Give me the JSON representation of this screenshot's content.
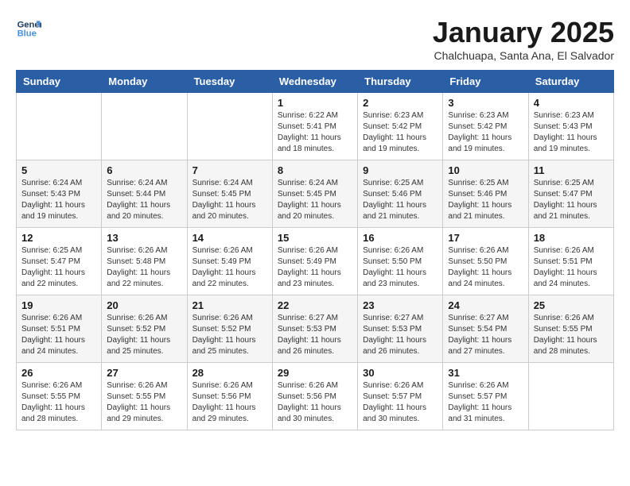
{
  "logo": {
    "line1": "General",
    "line2": "Blue"
  },
  "title": "January 2025",
  "subtitle": "Chalchuapa, Santa Ana, El Salvador",
  "weekdays": [
    "Sunday",
    "Monday",
    "Tuesday",
    "Wednesday",
    "Thursday",
    "Friday",
    "Saturday"
  ],
  "weeks": [
    [
      {
        "day": "",
        "info": ""
      },
      {
        "day": "",
        "info": ""
      },
      {
        "day": "",
        "info": ""
      },
      {
        "day": "1",
        "info": "Sunrise: 6:22 AM\nSunset: 5:41 PM\nDaylight: 11 hours\nand 18 minutes."
      },
      {
        "day": "2",
        "info": "Sunrise: 6:23 AM\nSunset: 5:42 PM\nDaylight: 11 hours\nand 19 minutes."
      },
      {
        "day": "3",
        "info": "Sunrise: 6:23 AM\nSunset: 5:42 PM\nDaylight: 11 hours\nand 19 minutes."
      },
      {
        "day": "4",
        "info": "Sunrise: 6:23 AM\nSunset: 5:43 PM\nDaylight: 11 hours\nand 19 minutes."
      }
    ],
    [
      {
        "day": "5",
        "info": "Sunrise: 6:24 AM\nSunset: 5:43 PM\nDaylight: 11 hours\nand 19 minutes."
      },
      {
        "day": "6",
        "info": "Sunrise: 6:24 AM\nSunset: 5:44 PM\nDaylight: 11 hours\nand 20 minutes."
      },
      {
        "day": "7",
        "info": "Sunrise: 6:24 AM\nSunset: 5:45 PM\nDaylight: 11 hours\nand 20 minutes."
      },
      {
        "day": "8",
        "info": "Sunrise: 6:24 AM\nSunset: 5:45 PM\nDaylight: 11 hours\nand 20 minutes."
      },
      {
        "day": "9",
        "info": "Sunrise: 6:25 AM\nSunset: 5:46 PM\nDaylight: 11 hours\nand 21 minutes."
      },
      {
        "day": "10",
        "info": "Sunrise: 6:25 AM\nSunset: 5:46 PM\nDaylight: 11 hours\nand 21 minutes."
      },
      {
        "day": "11",
        "info": "Sunrise: 6:25 AM\nSunset: 5:47 PM\nDaylight: 11 hours\nand 21 minutes."
      }
    ],
    [
      {
        "day": "12",
        "info": "Sunrise: 6:25 AM\nSunset: 5:47 PM\nDaylight: 11 hours\nand 22 minutes."
      },
      {
        "day": "13",
        "info": "Sunrise: 6:26 AM\nSunset: 5:48 PM\nDaylight: 11 hours\nand 22 minutes."
      },
      {
        "day": "14",
        "info": "Sunrise: 6:26 AM\nSunset: 5:49 PM\nDaylight: 11 hours\nand 22 minutes."
      },
      {
        "day": "15",
        "info": "Sunrise: 6:26 AM\nSunset: 5:49 PM\nDaylight: 11 hours\nand 23 minutes."
      },
      {
        "day": "16",
        "info": "Sunrise: 6:26 AM\nSunset: 5:50 PM\nDaylight: 11 hours\nand 23 minutes."
      },
      {
        "day": "17",
        "info": "Sunrise: 6:26 AM\nSunset: 5:50 PM\nDaylight: 11 hours\nand 24 minutes."
      },
      {
        "day": "18",
        "info": "Sunrise: 6:26 AM\nSunset: 5:51 PM\nDaylight: 11 hours\nand 24 minutes."
      }
    ],
    [
      {
        "day": "19",
        "info": "Sunrise: 6:26 AM\nSunset: 5:51 PM\nDaylight: 11 hours\nand 24 minutes."
      },
      {
        "day": "20",
        "info": "Sunrise: 6:26 AM\nSunset: 5:52 PM\nDaylight: 11 hours\nand 25 minutes."
      },
      {
        "day": "21",
        "info": "Sunrise: 6:26 AM\nSunset: 5:52 PM\nDaylight: 11 hours\nand 25 minutes."
      },
      {
        "day": "22",
        "info": "Sunrise: 6:27 AM\nSunset: 5:53 PM\nDaylight: 11 hours\nand 26 minutes."
      },
      {
        "day": "23",
        "info": "Sunrise: 6:27 AM\nSunset: 5:53 PM\nDaylight: 11 hours\nand 26 minutes."
      },
      {
        "day": "24",
        "info": "Sunrise: 6:27 AM\nSunset: 5:54 PM\nDaylight: 11 hours\nand 27 minutes."
      },
      {
        "day": "25",
        "info": "Sunrise: 6:26 AM\nSunset: 5:55 PM\nDaylight: 11 hours\nand 28 minutes."
      }
    ],
    [
      {
        "day": "26",
        "info": "Sunrise: 6:26 AM\nSunset: 5:55 PM\nDaylight: 11 hours\nand 28 minutes."
      },
      {
        "day": "27",
        "info": "Sunrise: 6:26 AM\nSunset: 5:55 PM\nDaylight: 11 hours\nand 29 minutes."
      },
      {
        "day": "28",
        "info": "Sunrise: 6:26 AM\nSunset: 5:56 PM\nDaylight: 11 hours\nand 29 minutes."
      },
      {
        "day": "29",
        "info": "Sunrise: 6:26 AM\nSunset: 5:56 PM\nDaylight: 11 hours\nand 30 minutes."
      },
      {
        "day": "30",
        "info": "Sunrise: 6:26 AM\nSunset: 5:57 PM\nDaylight: 11 hours\nand 30 minutes."
      },
      {
        "day": "31",
        "info": "Sunrise: 6:26 AM\nSunset: 5:57 PM\nDaylight: 11 hours\nand 31 minutes."
      },
      {
        "day": "",
        "info": ""
      }
    ]
  ]
}
